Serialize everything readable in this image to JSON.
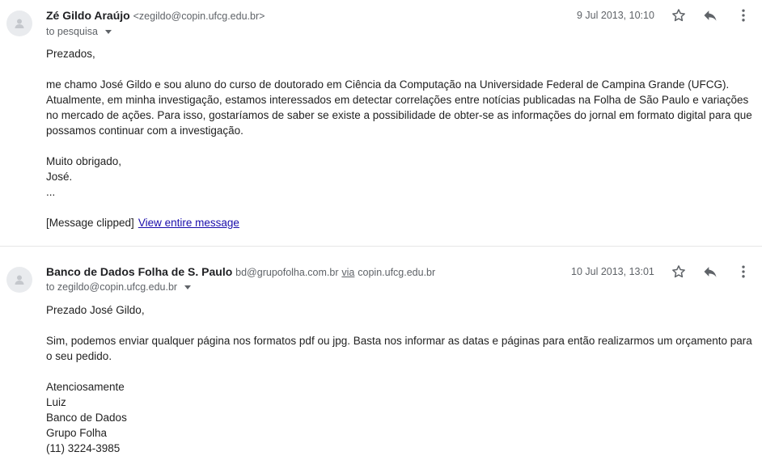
{
  "messages": [
    {
      "sender_name": "Zé Gildo Araújo",
      "sender_email": "<zegildo@copin.ufcg.edu.br>",
      "via_label": "",
      "via_domain": "",
      "to_line": "to pesquisa",
      "date": "9 Jul 2013, 10:10",
      "greeting": "Prezados,",
      "paragraph_1": "me chamo José Gildo e sou aluno do curso de doutorado em Ciência da Computação na Universidade Federal de Campina Grande (UFCG). Atualmente, em minha investigação, estamos interessados em detectar correlações entre notícias publicadas na Folha de São Paulo e variações no mercado de ações. Para isso, gostaríamos de saber se existe a possibilidade de obter-se as informações do jornal em formato digital para que possamos continuar com a investigação.",
      "closing": "Muito obrigado,",
      "signature": "José.",
      "ellipsis": "...",
      "clipped_text": "[Message clipped]",
      "view_entire_link": "View entire message"
    },
    {
      "sender_name": "Banco de Dados Folha de S. Paulo",
      "sender_email": "bd@grupofolha.com.br",
      "via_label": "via",
      "via_domain": "copin.ufcg.edu.br",
      "to_line": "to zegildo@copin.ufcg.edu.br",
      "date": "10 Jul 2013, 13:01",
      "greeting": "Prezado José Gildo,",
      "paragraph_1": "Sim, podemos enviar qualquer página nos formatos pdf ou jpg. Basta nos informar as datas e páginas para então realizarmos um orçamento para o seu pedido.",
      "closing": "Atenciosamente",
      "sig_lines": [
        "Luiz",
        "Banco de Dados",
        "Grupo Folha",
        "(11) 3224-3985"
      ]
    }
  ],
  "icons": {
    "avatar": "person-icon",
    "star": "star-icon",
    "reply": "reply-icon",
    "more": "more-vert-icon",
    "to_menu": "caret-down-icon"
  },
  "colors": {
    "link": "#1a0dab",
    "meta_text": "#5f6368",
    "avatar_bg": "#e9ebee"
  }
}
